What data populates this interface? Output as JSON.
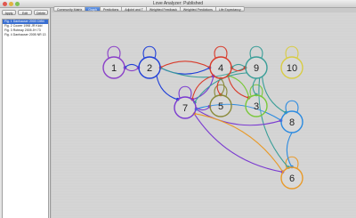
{
  "window": {
    "title": "Love Analyzer: Published"
  },
  "sidebar": {
    "buttons": [
      "Apply",
      "Edit",
      "Delete"
    ],
    "items": [
      "Fig. 1 Danhauser 2003 Cit54",
      "Fig. 2 Coorer 1998 JR Kidd",
      "Fig. 3 Rotmay 2005 JH 73",
      "Fig. 4 Danhauser 2005 NR 13"
    ],
    "selected_index": 0
  },
  "tabs": {
    "items": [
      "Community Matrix",
      "Graph",
      "Predictions",
      "Adjoint and T",
      "Weighted Feedback",
      "Weighted Predictions",
      "Life Expectancy"
    ],
    "active_index": 1
  },
  "graph": {
    "nodes": [
      {
        "id": "1",
        "label": "1",
        "color": "#8a3fc8"
      },
      {
        "id": "2",
        "label": "2",
        "color": "#1f3fd8"
      },
      {
        "id": "4",
        "label": "4",
        "color": "#d83a2a"
      },
      {
        "id": "9",
        "label": "9",
        "color": "#3a9e98"
      },
      {
        "id": "10",
        "label": "10",
        "color": "#d8cc44"
      },
      {
        "id": "7",
        "label": "7",
        "color": "#7a3ad0"
      },
      {
        "id": "5",
        "label": "5",
        "color": "#8a8a3a"
      },
      {
        "id": "3",
        "label": "3",
        "color": "#7ac83a"
      },
      {
        "id": "8",
        "label": "8",
        "color": "#2a8ae0"
      },
      {
        "id": "6",
        "label": "6",
        "color": "#e89a2a"
      }
    ],
    "edges": [
      {
        "from": "1",
        "to": "1",
        "color": "#8a3fc8"
      },
      {
        "from": "2",
        "to": "2",
        "color": "#1f3fd8"
      },
      {
        "from": "4",
        "to": "4",
        "color": "#d83a2a"
      },
      {
        "from": "9",
        "to": "9",
        "color": "#3a9e98"
      },
      {
        "from": "10",
        "to": "10",
        "color": "#d8cc44"
      },
      {
        "from": "7",
        "to": "7",
        "color": "#7a3ad0"
      },
      {
        "from": "5",
        "to": "5",
        "color": "#8a8a3a"
      },
      {
        "from": "3",
        "to": "3",
        "color": "#7ac83a"
      },
      {
        "from": "8",
        "to": "8",
        "color": "#2a8ae0"
      },
      {
        "from": "6",
        "to": "6",
        "color": "#e89a2a"
      },
      {
        "from": "2",
        "to": "1",
        "color": "#1f3fd8"
      },
      {
        "from": "1",
        "to": "2",
        "color": "#8a3fc8"
      },
      {
        "from": "2",
        "to": "4",
        "color": "#1f3fd8"
      },
      {
        "from": "4",
        "to": "2",
        "color": "#d83a2a"
      },
      {
        "from": "2",
        "to": "9",
        "color": "#3a9e98"
      },
      {
        "from": "9",
        "to": "4",
        "color": "#3a9e98"
      },
      {
        "from": "4",
        "to": "9",
        "color": "#d83a2a"
      },
      {
        "from": "2",
        "to": "7",
        "color": "#1f3fd8"
      },
      {
        "from": "4",
        "to": "7",
        "color": "#d83a2a"
      },
      {
        "from": "4",
        "to": "5",
        "color": "#d83a2a"
      },
      {
        "from": "4",
        "to": "3",
        "color": "#d83a2a"
      },
      {
        "from": "7",
        "to": "4",
        "color": "#7a3ad0"
      },
      {
        "from": "5",
        "to": "4",
        "color": "#8a8a3a"
      },
      {
        "from": "9",
        "to": "3",
        "color": "#3a9e98"
      },
      {
        "from": "9",
        "to": "8",
        "color": "#3a9e98"
      },
      {
        "from": "9",
        "to": "6",
        "color": "#3a9e98"
      },
      {
        "from": "3",
        "to": "4",
        "color": "#7ac83a"
      },
      {
        "from": "7",
        "to": "8",
        "color": "#7a3ad0"
      },
      {
        "from": "7",
        "to": "6",
        "color": "#7a3ad0"
      },
      {
        "from": "6",
        "to": "7",
        "color": "#e89a2a"
      },
      {
        "from": "8",
        "to": "7",
        "color": "#2a8ae0"
      },
      {
        "from": "8",
        "to": "6",
        "color": "#2a8ae0"
      },
      {
        "from": "7",
        "to": "5",
        "color": "#7a3ad0"
      },
      {
        "from": "9",
        "to": "7",
        "color": "#3a9e98"
      }
    ]
  }
}
